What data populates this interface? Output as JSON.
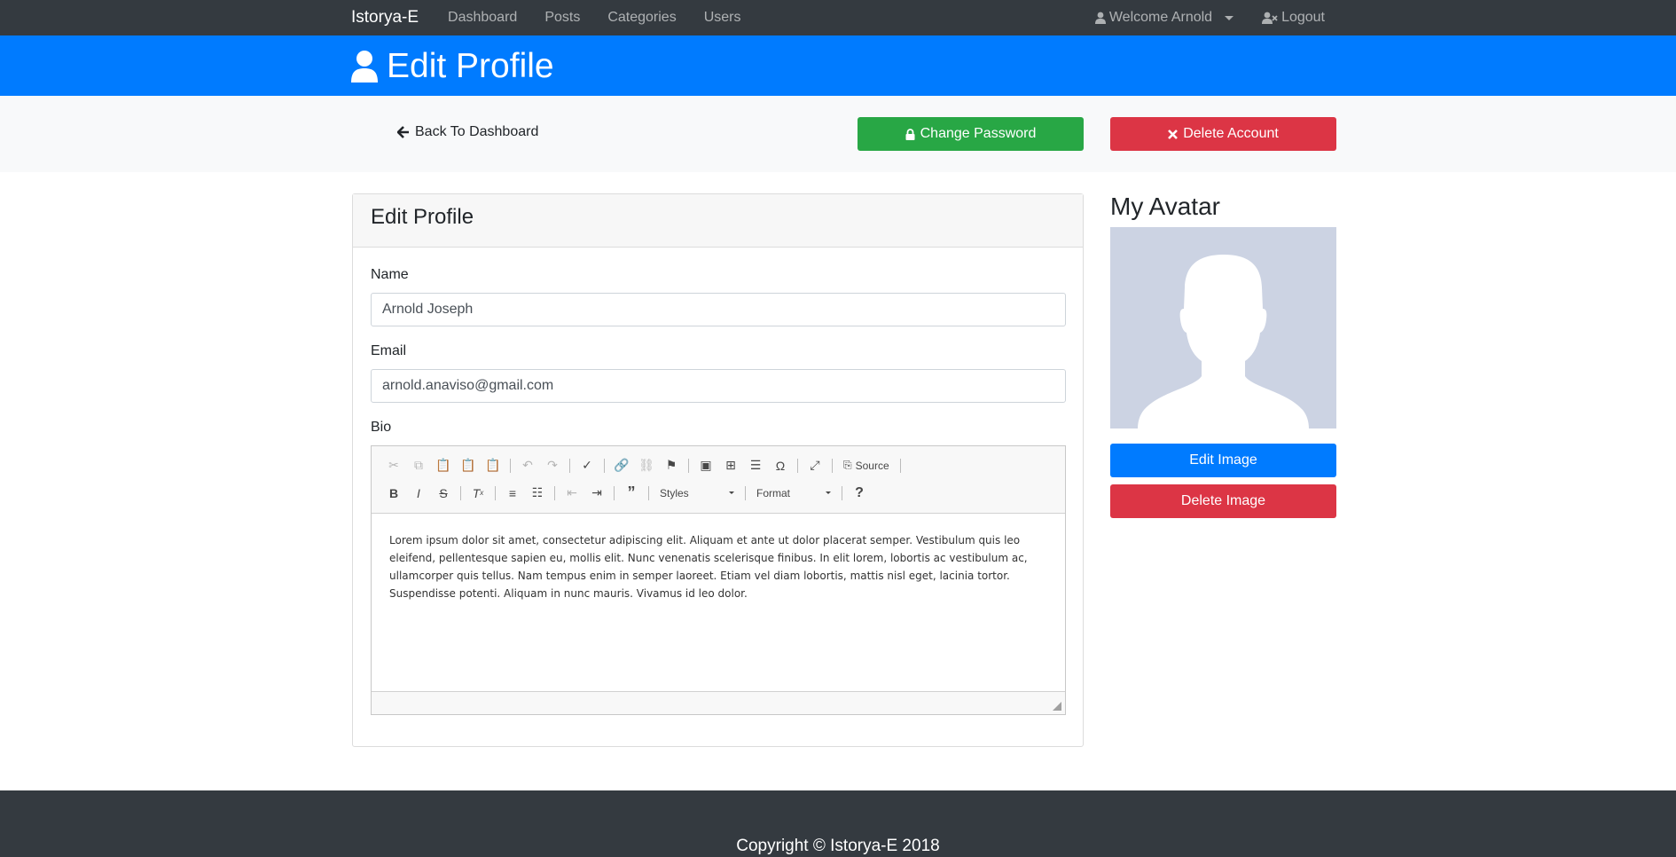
{
  "navbar": {
    "brand": "Istorya-E",
    "links": [
      "Dashboard",
      "Posts",
      "Categories",
      "Users"
    ],
    "user_menu_label": "Welcome Arnold",
    "logout_label": "Logout"
  },
  "header": {
    "title": "Edit Profile",
    "icon": "user-icon"
  },
  "actions": {
    "back_label": "Back To Dashboard",
    "change_password_label": "Change Password",
    "delete_account_label": "Delete Account"
  },
  "form": {
    "card_title": "Edit Profile",
    "name_label": "Name",
    "name_value": "Arnold Joseph",
    "email_label": "Email",
    "email_value": "arnold.anaviso@gmail.com",
    "bio_label": "Bio",
    "bio_text": "Lorem ipsum dolor sit amet, consectetur adipiscing elit. Aliquam et ante ut dolor placerat semper. Vestibulum quis leo eleifend, pellentesque sapien eu, mollis elit. Nunc venenatis scelerisque finibus. In elit lorem, lobortis ac vestibulum ac, ullamcorper quis tellus. Nam tempus enim in semper laoreet. Etiam vel diam lobortis, mattis nisl eget, lacinia tortor. Suspendisse potenti. Aliquam in nunc mauris. Vivamus id leo dolor."
  },
  "editor_toolbar": {
    "source_label": "Source",
    "styles_label": "Styles",
    "format_label": "Format"
  },
  "avatar": {
    "title": "My Avatar",
    "edit_label": "Edit Image",
    "delete_label": "Delete Image"
  },
  "footer": {
    "copyright": "Copyright © Istorya-E 2018"
  },
  "colors": {
    "navbar": "#343a40",
    "primary": "#007bff",
    "success": "#28a745",
    "danger": "#dc3545",
    "avatar_bg": "#ccd3e3"
  }
}
